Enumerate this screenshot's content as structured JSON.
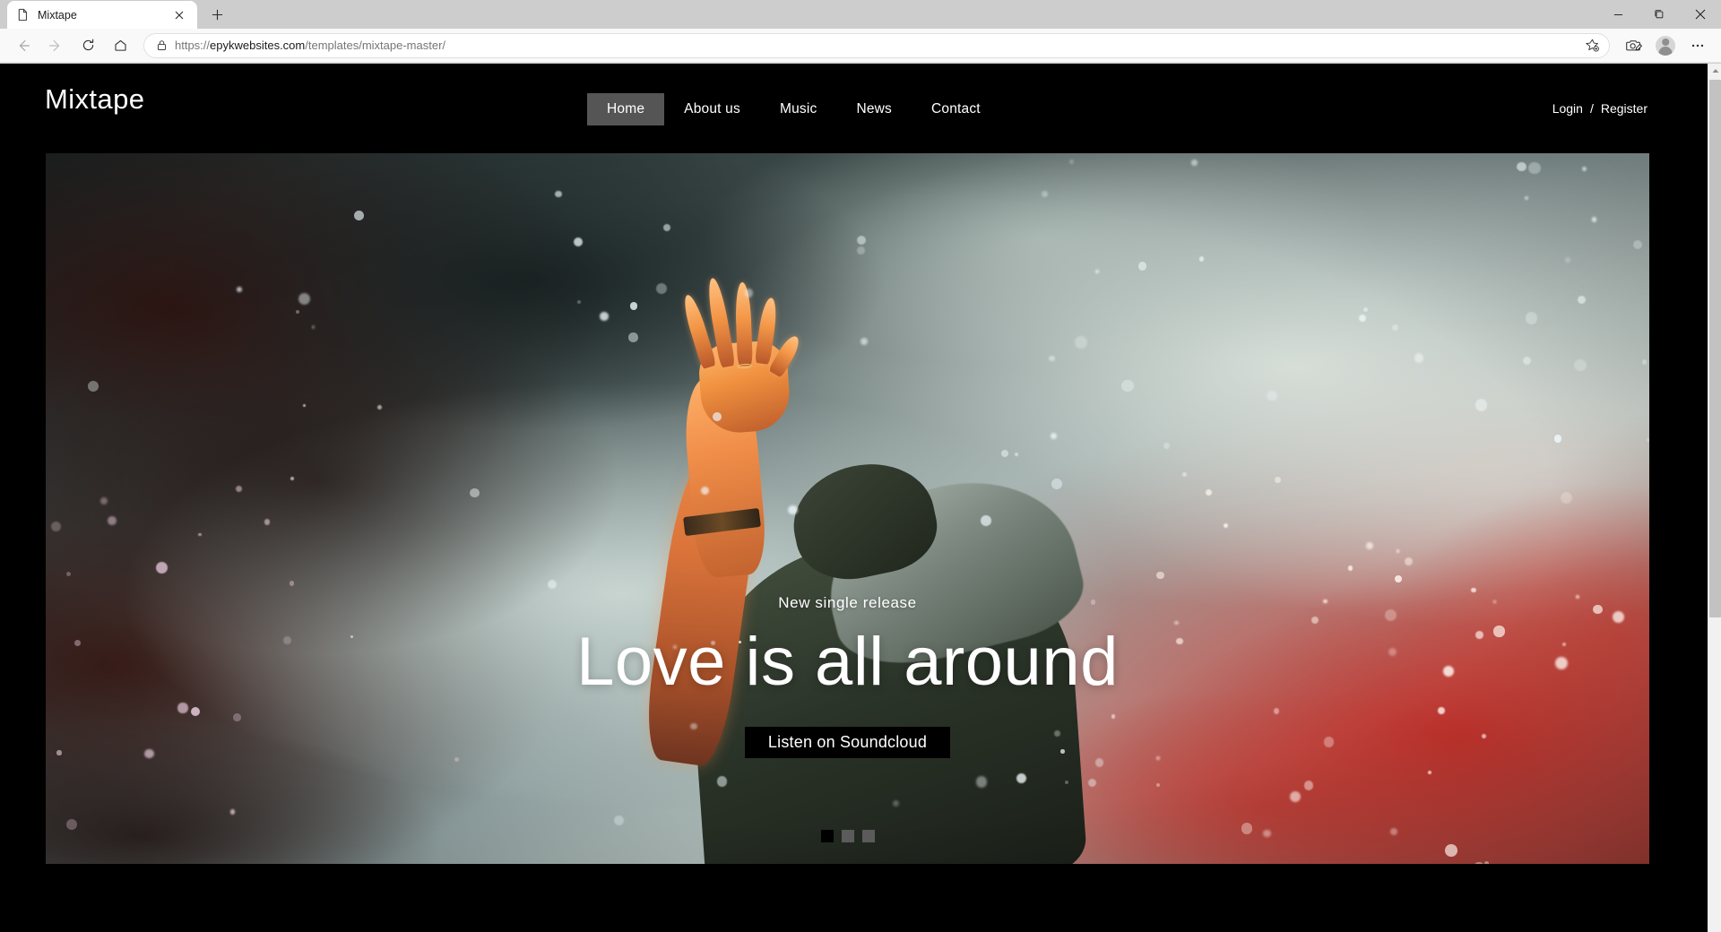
{
  "browser": {
    "tab": {
      "title": "Mixtape",
      "favicon_icon": "page-icon",
      "close_icon": "close-icon"
    },
    "new_tab_icon": "plus-icon",
    "window_controls": {
      "minimize_icon": "minimize-icon",
      "maximize_icon": "maximize-icon",
      "close_icon": "window-close-icon"
    },
    "toolbar": {
      "back_icon": "back-arrow-icon",
      "forward_icon": "forward-arrow-icon",
      "reload_icon": "reload-icon",
      "home_icon": "home-icon",
      "favorite_icon": "add-favorite-star-icon",
      "collections_icon": "collections-icon",
      "profile_icon": "profile-avatar-icon",
      "settings_icon": "more-ellipsis-icon"
    },
    "omnibox": {
      "lock_icon": "lock-icon",
      "url_scheme": "https://",
      "url_domain": "epykwebsites.com",
      "url_path": "/templates/mixtape-master/",
      "url_full": "https://epykwebsites.com/templates/mixtape-master/"
    },
    "scrollbar": {
      "up_arrow_icon": "scroll-up-arrow-icon"
    }
  },
  "site": {
    "brand": "Mixtape",
    "nav": [
      {
        "label": "Home",
        "active": true
      },
      {
        "label": "About us",
        "active": false
      },
      {
        "label": "Music",
        "active": false
      },
      {
        "label": "News",
        "active": false
      },
      {
        "label": "Contact",
        "active": false
      }
    ],
    "auth": {
      "login": "Login",
      "separator": "/",
      "register": "Register"
    },
    "hero": {
      "eyebrow": "New single release",
      "headline": "Love is all around",
      "cta_label": "Listen on Soundcloud",
      "slides": [
        {
          "active": true
        },
        {
          "active": false
        },
        {
          "active": false
        }
      ]
    }
  },
  "colors": {
    "page_background": "#000000",
    "nav_active_background": "#555555",
    "text_on_dark": "#ffffff",
    "cta_background": "#000000",
    "dot_active": "#000000",
    "dot_inactive": "#5b5b5b",
    "browser_chrome": "#f9f9f9",
    "titlebar": "#cdcdcd"
  }
}
